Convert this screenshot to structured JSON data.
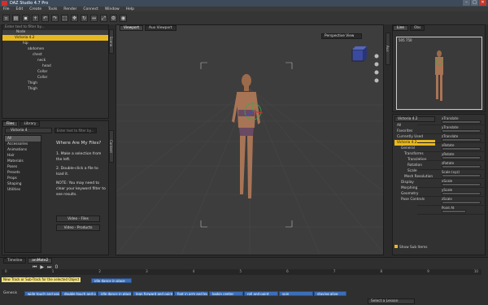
{
  "window": {
    "title": "DAZ Studio 4.7 Pro",
    "min": "–",
    "max": "□",
    "close": "✕"
  },
  "menu": [
    "File",
    "Edit",
    "Create",
    "Tools",
    "Render",
    "Connect",
    "Window",
    "Help"
  ],
  "scene": {
    "search_placeholder": "Enter text to filter by...",
    "col_node": "Node",
    "items": [
      "Victoria 4.2",
      "hip",
      "abdomen",
      "chest",
      "neck",
      "head",
      "Collar",
      "Collar",
      "Thigh",
      "Thigh"
    ]
  },
  "files": {
    "tab_files": "Files",
    "tab_other": "Library",
    "dropdown": "Victoria 4",
    "filter_placeholder": "Enter text to filter by...",
    "categories": [
      "All",
      "Accessories",
      "Animations",
      "Hair",
      "Materials",
      "Poses",
      "Presets",
      "Props",
      "Shaping",
      "Utilities"
    ],
    "heading": "Where Are My Files?",
    "step1": "1. Make a selection from the left.",
    "step2": "2. Double-click a file to load it.",
    "note": "NOTE: You may need to clear your keyword filter to see results.",
    "btn_videos_files": "Video - Files",
    "btn_videos_products": "Video - Products"
  },
  "viewport": {
    "tab": "Viewport",
    "tab2": "Aux Viewport",
    "view_select": "Perspective View"
  },
  "aux": {
    "tabs": [
      "Line",
      "Obs"
    ],
    "num": "505 750"
  },
  "params": {
    "dropdown": "Victoria 4.2",
    "filters": [
      "All",
      "Favorites",
      "Currently Used",
      "Victoria 4.2"
    ],
    "tree": [
      "General",
      "Transforms",
      "Translation",
      "Rotation",
      "Scale",
      "Mesh Resolution",
      "Display",
      "Morphing",
      "Geometry",
      "Pose Controls"
    ],
    "values": [
      {
        "label": "xTranslate",
        "value": "0.00"
      },
      {
        "label": "yTranslate",
        "value": "0.00"
      },
      {
        "label": "zTranslate",
        "value": "0.00"
      },
      {
        "label": "xRotate",
        "value": "0.00"
      },
      {
        "label": "yRotate",
        "value": "0.00"
      },
      {
        "label": "zRotate",
        "value": "0.00"
      },
      {
        "label": "Scale (xyz)",
        "value": "100%"
      },
      {
        "label": "xScale",
        "value": "100%"
      },
      {
        "label": "yScale",
        "value": "100%"
      },
      {
        "label": "zScale",
        "value": "100%"
      },
      {
        "label": "Point At",
        "value": "None"
      }
    ],
    "show_sub": "Show Sub Items"
  },
  "timeline": {
    "tab1": "Timeline",
    "tab2": "aniMate2",
    "frame": "0",
    "tooltip": "New Track or Sub-Track for the selected Object",
    "track_label": "Genesis",
    "clips": [
      "idle dance in place",
      "wide touch and point",
      "double touch and point",
      "idle dance in place",
      "lean forward and point",
      "foot in arm and leg",
      "lookin center",
      "roll and point",
      "spin",
      "staying alive"
    ],
    "ticks": [
      "0",
      "1",
      "2",
      "3",
      "4",
      "5",
      "6",
      "7",
      "8",
      "9",
      "10"
    ],
    "lesson": "Select a Lesson"
  }
}
